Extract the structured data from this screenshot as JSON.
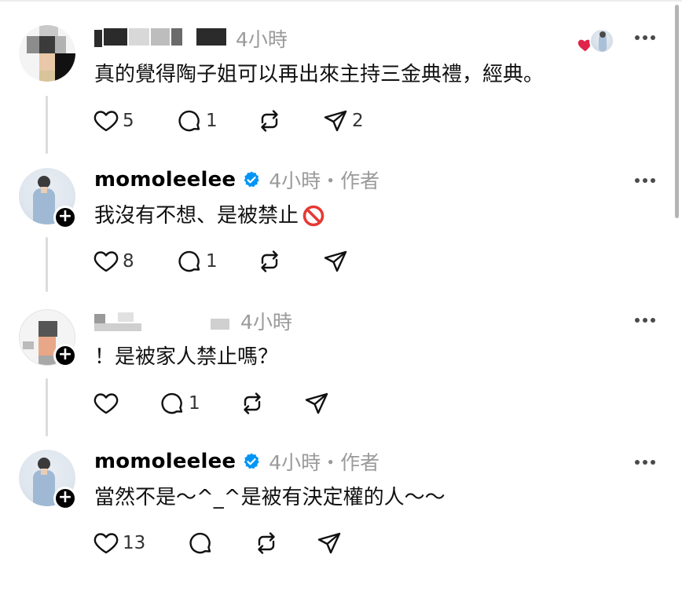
{
  "colors": {
    "text": "#000000",
    "secondary_text": "#9a9a9a",
    "verified_blue": "#0095f6",
    "heart_red": "#e0244a",
    "thread_line": "#dcdcdc"
  },
  "posts": [
    {
      "username": "",
      "time": "4小時",
      "text": "真的覺得陶子姐可以再出來主持三金典禮，經典。",
      "liked_by_author": true,
      "likes": "5",
      "replies": "1",
      "reposts": "",
      "shares": "2"
    },
    {
      "username": "momoleelee",
      "verified": true,
      "time": "4小時・作者",
      "text": "我沒有不想、是被禁止",
      "emoji": "prohibited-icon",
      "likes": "8",
      "replies": "1",
      "reposts": "",
      "shares": ""
    },
    {
      "username": "",
      "time": "4小時",
      "text": "！是被家人禁止嗎？",
      "likes": "",
      "replies": "1",
      "reposts": "",
      "shares": ""
    },
    {
      "username": "momoleelee",
      "verified": true,
      "time": "4小時・作者",
      "text": "當然不是～^_^是被有決定權的人～～",
      "likes": "13",
      "replies": "",
      "reposts": "",
      "shares": ""
    }
  ],
  "icons": {
    "like": "heart-icon",
    "reply": "comment-icon",
    "repost": "repost-icon",
    "share": "send-icon",
    "more": "more-icon",
    "follow": "plus-icon",
    "verified": "verified-badge-icon"
  }
}
